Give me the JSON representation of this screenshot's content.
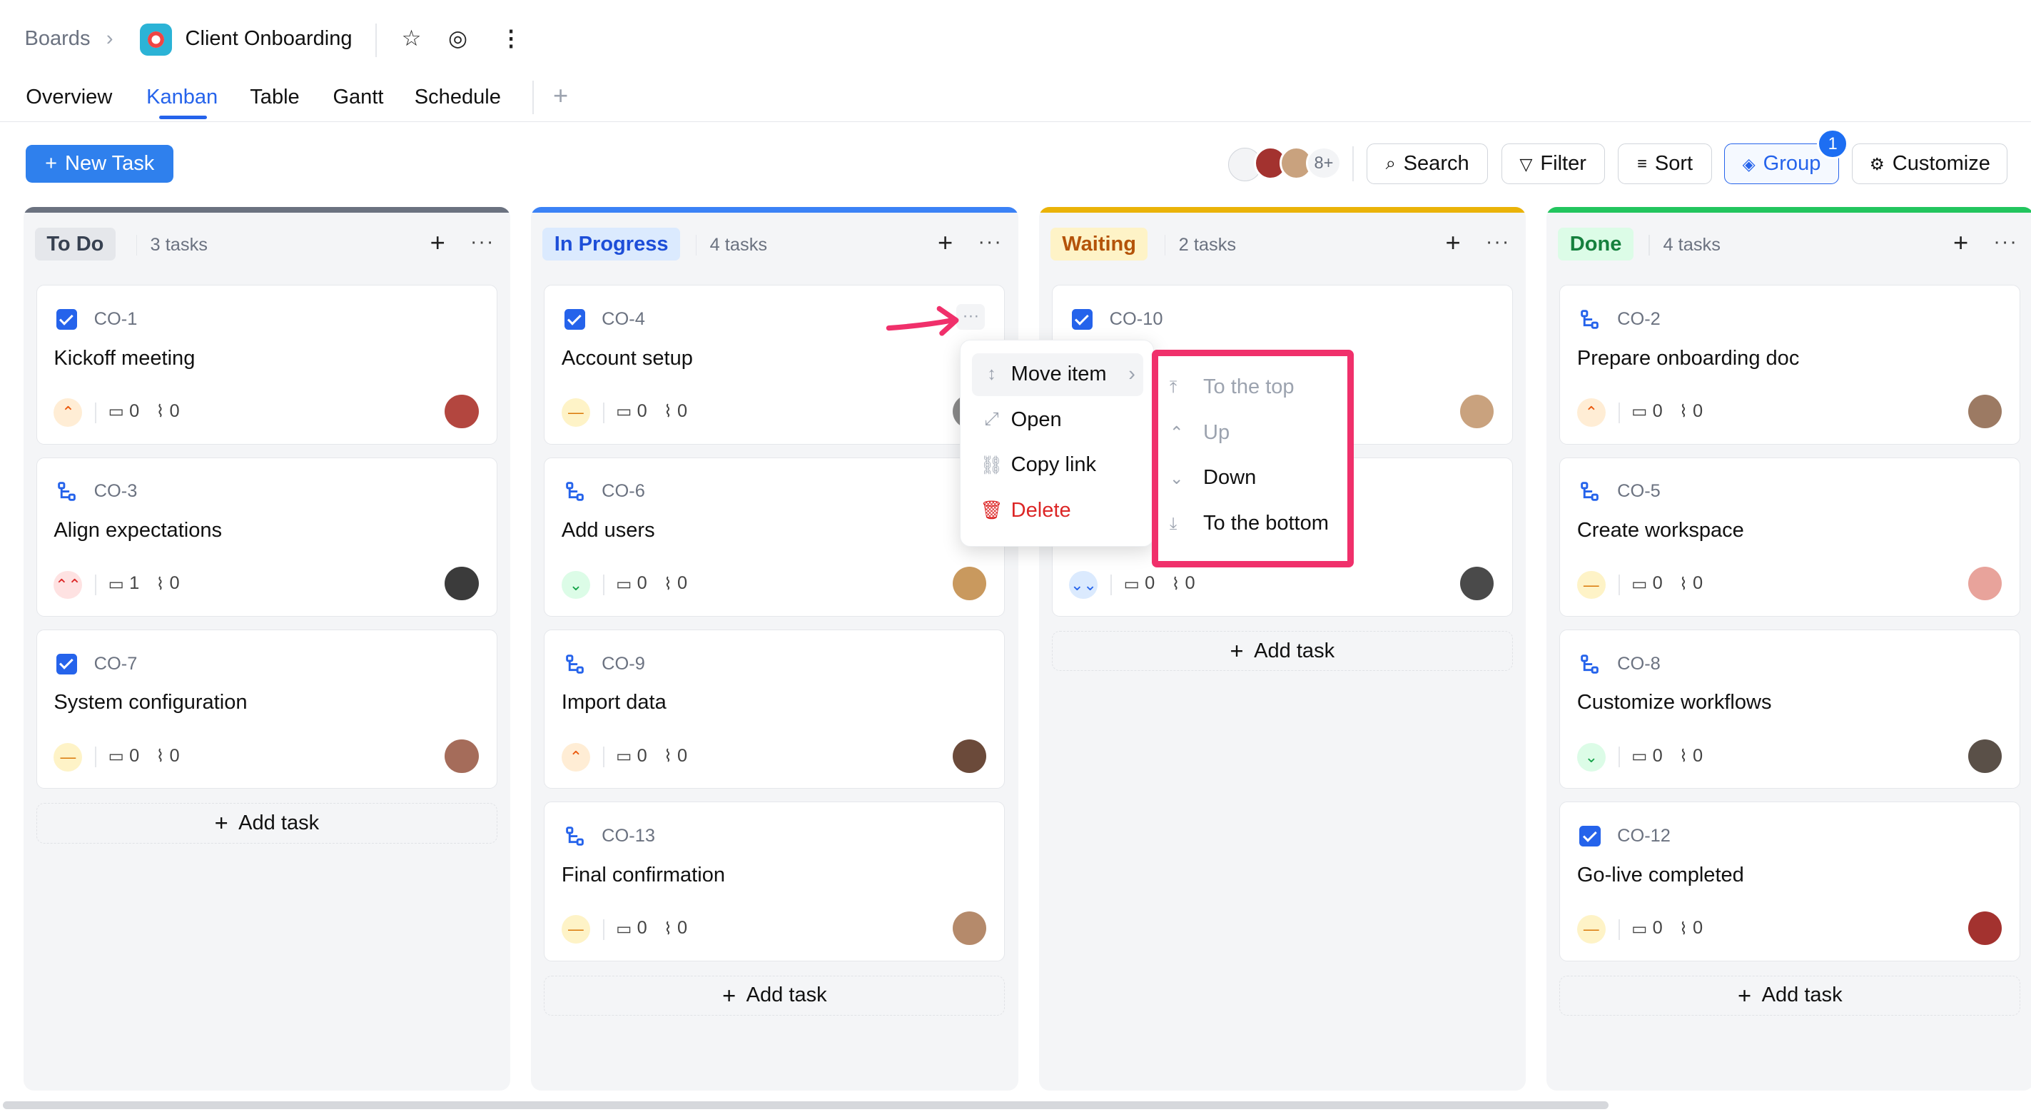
{
  "header": {
    "breadcrumb": "Boards",
    "board_title": "Client Onboarding"
  },
  "tabs": [
    "Overview",
    "Kanban",
    "Table",
    "Gantt",
    "Schedule"
  ],
  "toolbar": {
    "new_task": "New Task",
    "avatars_more": "8+",
    "search": "Search",
    "filter": "Filter",
    "sort": "Sort",
    "group": "Group",
    "group_badge": "1",
    "customize": "Customize"
  },
  "columns": [
    {
      "title": "To Do",
      "count": "3 tasks",
      "bar_color": "#6b7280",
      "title_bg": "#e5e7eb",
      "title_color": "#374151",
      "cards": [
        {
          "kind": "check",
          "id": "CO-1",
          "title": "Kickoff meeting",
          "priority": "high",
          "comments": "0",
          "attachments": "0",
          "avatar": "#b3463f"
        },
        {
          "kind": "sub",
          "id": "CO-3",
          "title": "Align expectations",
          "priority": "urgent",
          "comments": "1",
          "attachments": "0",
          "avatar": "#3b3b3b"
        },
        {
          "kind": "check",
          "id": "CO-7",
          "title": "System configuration",
          "priority": "med",
          "comments": "0",
          "attachments": "0",
          "avatar": "#a56c5a"
        }
      ],
      "add_label": "Add task"
    },
    {
      "title": "In Progress",
      "count": "4 tasks",
      "bar_color": "#3b82f6",
      "title_bg": "#dbeafe",
      "title_color": "#1d4ed8",
      "cards": [
        {
          "kind": "check",
          "id": "CO-4",
          "title": "Account setup",
          "priority": "med",
          "comments": "0",
          "attachments": "0",
          "avatar": "#8a8a8a"
        },
        {
          "kind": "sub",
          "id": "CO-6",
          "title": "Add users",
          "priority": "low",
          "comments": "0",
          "attachments": "0",
          "avatar": "#c9995e"
        },
        {
          "kind": "sub",
          "id": "CO-9",
          "title": "Import data",
          "priority": "high",
          "comments": "0",
          "attachments": "0",
          "avatar": "#6b4a3a"
        },
        {
          "kind": "sub",
          "id": "CO-13",
          "title": "Final confirmation",
          "priority": "med",
          "comments": "0",
          "attachments": "0",
          "avatar": "#b58a6b"
        }
      ],
      "add_label": "Add task"
    },
    {
      "title": "Waiting",
      "count": "2 tasks",
      "bar_color": "#eab308",
      "title_bg": "#fef3c7",
      "title_color": "#b45309",
      "cards": [
        {
          "kind": "check",
          "id": "CO-10",
          "title": "",
          "priority": "",
          "comments": "",
          "attachments": "",
          "avatar": "#c9a27e"
        },
        {
          "kind": "",
          "id": "",
          "title": "",
          "priority": "lowest",
          "comments": "0",
          "attachments": "0",
          "avatar": "#4a4a4a"
        }
      ],
      "add_label": "Add task"
    },
    {
      "title": "Done",
      "count": "4 tasks",
      "bar_color": "#22c55e",
      "title_bg": "#dcfce7",
      "title_color": "#15803d",
      "cards": [
        {
          "kind": "sub",
          "id": "CO-2",
          "title": "Prepare onboarding doc",
          "priority": "high",
          "comments": "0",
          "attachments": "0",
          "avatar": "#9c7a63"
        },
        {
          "kind": "sub",
          "id": "CO-5",
          "title": "Create workspace",
          "priority": "med",
          "comments": "0",
          "attachments": "0",
          "avatar": "#e8a39b"
        },
        {
          "kind": "sub",
          "id": "CO-8",
          "title": "Customize workflows",
          "priority": "low",
          "comments": "0",
          "attachments": "0",
          "avatar": "#5a5048"
        },
        {
          "kind": "check",
          "id": "CO-12",
          "title": "Go-live completed",
          "priority": "med",
          "comments": "0",
          "attachments": "0",
          "avatar": "#a3322f"
        }
      ],
      "add_label": "Add task"
    }
  ],
  "context_menu": {
    "move_item": "Move item",
    "open": "Open",
    "copy_link": "Copy link",
    "delete": "Delete"
  },
  "move_submenu": {
    "to_top": "To the top",
    "up": "Up",
    "down": "Down",
    "to_bottom": "To the bottom"
  }
}
